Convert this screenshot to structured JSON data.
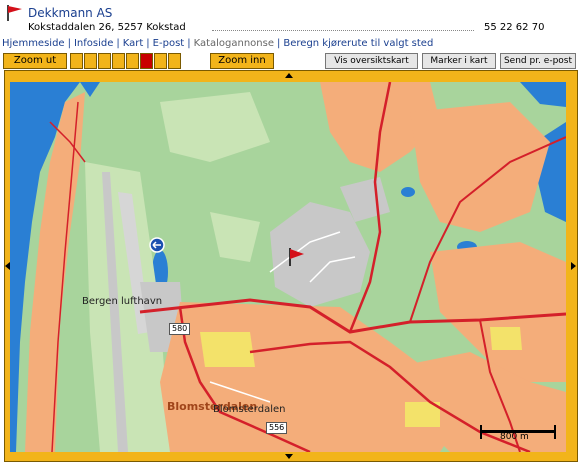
{
  "header": {
    "company_name": "Dekkmann AS",
    "address": "Kokstaddalen 26, 5257 Kokstad",
    "phone": "55 22 62 70"
  },
  "nav_links": [
    {
      "label": "Hjemmeside",
      "link": true
    },
    {
      "label": "Infoside",
      "link": true
    },
    {
      "label": "Kart",
      "link": true
    },
    {
      "label": "E-post",
      "link": true
    },
    {
      "label": "Katalogannonse",
      "link": false
    },
    {
      "label": "Beregn kjørerute til valgt sted",
      "link": true
    }
  ],
  "toolbar": {
    "zoom_out": "Zoom ut",
    "zoom_in": "Zoom inn",
    "zoom_steps": 8,
    "zoom_active_step": 5,
    "overview_map": "Vis oversiktskart",
    "mark_in_map": "Marker i kart",
    "send_email": "Send pr. e-post"
  },
  "map": {
    "labels": {
      "airport": "Bergen lufthavn",
      "place_highlight": "Blomsterdalen",
      "place": "Blomsterdalen"
    },
    "road_numbers": [
      "580",
      "556"
    ],
    "scale_label": "800 m",
    "colors": {
      "forest": "#a8d49c",
      "water": "#2a7fd4",
      "residential": "#f4ad7a",
      "industrial": "#c8c8c8",
      "road_main": "#d4202a",
      "frame": "#f2b41a"
    }
  }
}
